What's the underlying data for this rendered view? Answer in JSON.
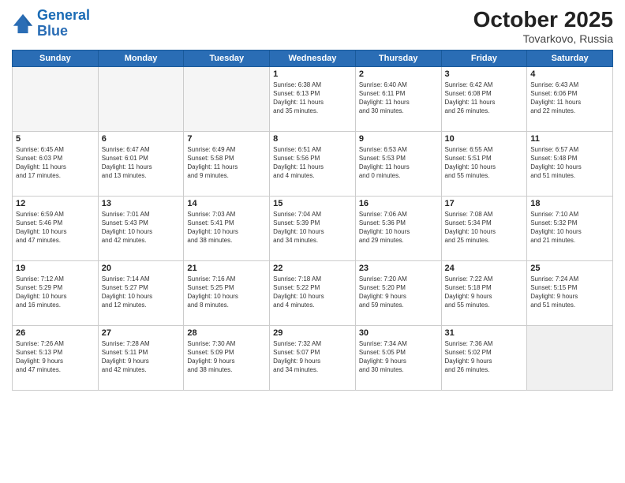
{
  "header": {
    "logo_line1": "General",
    "logo_line2": "Blue",
    "month": "October 2025",
    "location": "Tovarkovo, Russia"
  },
  "days_of_week": [
    "Sunday",
    "Monday",
    "Tuesday",
    "Wednesday",
    "Thursday",
    "Friday",
    "Saturday"
  ],
  "weeks": [
    [
      {
        "day": "",
        "info": "",
        "empty": true
      },
      {
        "day": "",
        "info": "",
        "empty": true
      },
      {
        "day": "",
        "info": "",
        "empty": true
      },
      {
        "day": "1",
        "info": "Sunrise: 6:38 AM\nSunset: 6:13 PM\nDaylight: 11 hours\nand 35 minutes."
      },
      {
        "day": "2",
        "info": "Sunrise: 6:40 AM\nSunset: 6:11 PM\nDaylight: 11 hours\nand 30 minutes."
      },
      {
        "day": "3",
        "info": "Sunrise: 6:42 AM\nSunset: 6:08 PM\nDaylight: 11 hours\nand 26 minutes."
      },
      {
        "day": "4",
        "info": "Sunrise: 6:43 AM\nSunset: 6:06 PM\nDaylight: 11 hours\nand 22 minutes."
      }
    ],
    [
      {
        "day": "5",
        "info": "Sunrise: 6:45 AM\nSunset: 6:03 PM\nDaylight: 11 hours\nand 17 minutes."
      },
      {
        "day": "6",
        "info": "Sunrise: 6:47 AM\nSunset: 6:01 PM\nDaylight: 11 hours\nand 13 minutes."
      },
      {
        "day": "7",
        "info": "Sunrise: 6:49 AM\nSunset: 5:58 PM\nDaylight: 11 hours\nand 9 minutes."
      },
      {
        "day": "8",
        "info": "Sunrise: 6:51 AM\nSunset: 5:56 PM\nDaylight: 11 hours\nand 4 minutes."
      },
      {
        "day": "9",
        "info": "Sunrise: 6:53 AM\nSunset: 5:53 PM\nDaylight: 11 hours\nand 0 minutes."
      },
      {
        "day": "10",
        "info": "Sunrise: 6:55 AM\nSunset: 5:51 PM\nDaylight: 10 hours\nand 55 minutes."
      },
      {
        "day": "11",
        "info": "Sunrise: 6:57 AM\nSunset: 5:48 PM\nDaylight: 10 hours\nand 51 minutes."
      }
    ],
    [
      {
        "day": "12",
        "info": "Sunrise: 6:59 AM\nSunset: 5:46 PM\nDaylight: 10 hours\nand 47 minutes."
      },
      {
        "day": "13",
        "info": "Sunrise: 7:01 AM\nSunset: 5:43 PM\nDaylight: 10 hours\nand 42 minutes."
      },
      {
        "day": "14",
        "info": "Sunrise: 7:03 AM\nSunset: 5:41 PM\nDaylight: 10 hours\nand 38 minutes."
      },
      {
        "day": "15",
        "info": "Sunrise: 7:04 AM\nSunset: 5:39 PM\nDaylight: 10 hours\nand 34 minutes."
      },
      {
        "day": "16",
        "info": "Sunrise: 7:06 AM\nSunset: 5:36 PM\nDaylight: 10 hours\nand 29 minutes."
      },
      {
        "day": "17",
        "info": "Sunrise: 7:08 AM\nSunset: 5:34 PM\nDaylight: 10 hours\nand 25 minutes."
      },
      {
        "day": "18",
        "info": "Sunrise: 7:10 AM\nSunset: 5:32 PM\nDaylight: 10 hours\nand 21 minutes."
      }
    ],
    [
      {
        "day": "19",
        "info": "Sunrise: 7:12 AM\nSunset: 5:29 PM\nDaylight: 10 hours\nand 16 minutes."
      },
      {
        "day": "20",
        "info": "Sunrise: 7:14 AM\nSunset: 5:27 PM\nDaylight: 10 hours\nand 12 minutes."
      },
      {
        "day": "21",
        "info": "Sunrise: 7:16 AM\nSunset: 5:25 PM\nDaylight: 10 hours\nand 8 minutes."
      },
      {
        "day": "22",
        "info": "Sunrise: 7:18 AM\nSunset: 5:22 PM\nDaylight: 10 hours\nand 4 minutes."
      },
      {
        "day": "23",
        "info": "Sunrise: 7:20 AM\nSunset: 5:20 PM\nDaylight: 9 hours\nand 59 minutes."
      },
      {
        "day": "24",
        "info": "Sunrise: 7:22 AM\nSunset: 5:18 PM\nDaylight: 9 hours\nand 55 minutes."
      },
      {
        "day": "25",
        "info": "Sunrise: 7:24 AM\nSunset: 5:15 PM\nDaylight: 9 hours\nand 51 minutes."
      }
    ],
    [
      {
        "day": "26",
        "info": "Sunrise: 7:26 AM\nSunset: 5:13 PM\nDaylight: 9 hours\nand 47 minutes."
      },
      {
        "day": "27",
        "info": "Sunrise: 7:28 AM\nSunset: 5:11 PM\nDaylight: 9 hours\nand 42 minutes."
      },
      {
        "day": "28",
        "info": "Sunrise: 7:30 AM\nSunset: 5:09 PM\nDaylight: 9 hours\nand 38 minutes."
      },
      {
        "day": "29",
        "info": "Sunrise: 7:32 AM\nSunset: 5:07 PM\nDaylight: 9 hours\nand 34 minutes."
      },
      {
        "day": "30",
        "info": "Sunrise: 7:34 AM\nSunset: 5:05 PM\nDaylight: 9 hours\nand 30 minutes."
      },
      {
        "day": "31",
        "info": "Sunrise: 7:36 AM\nSunset: 5:02 PM\nDaylight: 9 hours\nand 26 minutes."
      },
      {
        "day": "",
        "info": "",
        "empty": true,
        "shaded": true
      }
    ]
  ]
}
